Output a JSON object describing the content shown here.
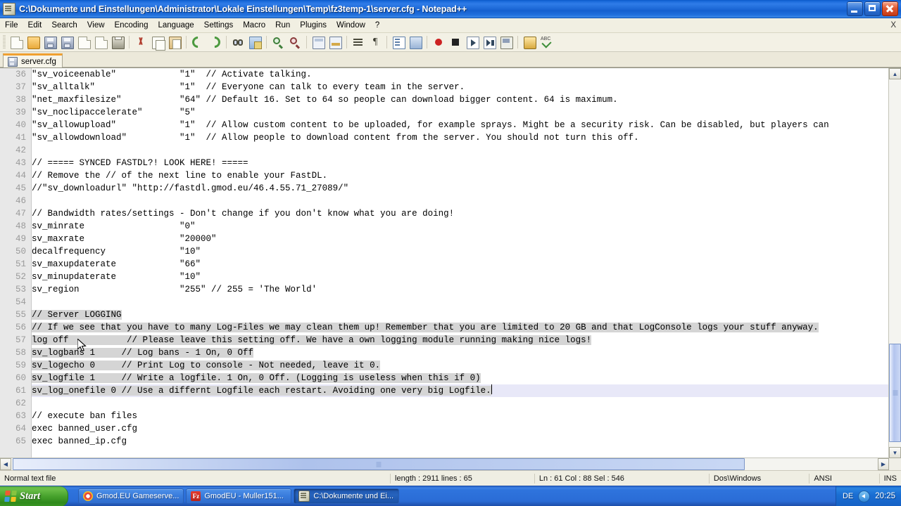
{
  "window": {
    "title": "C:\\Dokumente und Einstellungen\\Administrator\\Lokale Einstellungen\\Temp\\fz3temp-1\\server.cfg - Notepad++",
    "icon": "notepad-plus-plus-icon",
    "minimize_label": "Minimize",
    "maximize_label": "Restore",
    "close_label": "Close"
  },
  "menu": {
    "items": [
      {
        "label": "File"
      },
      {
        "label": "Edit"
      },
      {
        "label": "Search"
      },
      {
        "label": "View"
      },
      {
        "label": "Encoding"
      },
      {
        "label": "Language"
      },
      {
        "label": "Settings"
      },
      {
        "label": "Macro"
      },
      {
        "label": "Run"
      },
      {
        "label": "Plugins"
      },
      {
        "label": "Window"
      },
      {
        "label": "?"
      }
    ],
    "close_document_label": "X"
  },
  "toolbar": {
    "buttons": [
      {
        "name": "new-file-icon",
        "icon": "ic-doc"
      },
      {
        "name": "open-file-icon",
        "icon": "ic-folder"
      },
      {
        "name": "save-icon",
        "icon": "ic-save"
      },
      {
        "name": "save-all-icon",
        "icon": "ic-save"
      },
      {
        "name": "close-file-icon",
        "icon": "ic-doc"
      },
      {
        "name": "close-all-icon",
        "icon": "ic-doc"
      },
      {
        "name": "print-icon",
        "icon": "ic-print"
      },
      {
        "name": "sep",
        "icon": "sep"
      },
      {
        "name": "cut-icon",
        "icon": "ic-cut"
      },
      {
        "name": "copy-icon",
        "icon": "ic-copy"
      },
      {
        "name": "paste-icon",
        "icon": "ic-paste"
      },
      {
        "name": "sep",
        "icon": "sep"
      },
      {
        "name": "undo-icon",
        "icon": "ic-undo"
      },
      {
        "name": "redo-icon",
        "icon": "ic-redo"
      },
      {
        "name": "sep",
        "icon": "sep"
      },
      {
        "name": "find-icon",
        "icon": "ic-find"
      },
      {
        "name": "replace-icon",
        "icon": "ic-replace"
      },
      {
        "name": "sep",
        "icon": "sep"
      },
      {
        "name": "zoom-in-icon",
        "icon": "ic-zoomin"
      },
      {
        "name": "zoom-out-icon",
        "icon": "ic-zoomout"
      },
      {
        "name": "sep",
        "icon": "sep"
      },
      {
        "name": "sync-vertical-icon",
        "icon": "ic-sync"
      },
      {
        "name": "sync-horizontal-icon",
        "icon": "ic-sync2"
      },
      {
        "name": "sep",
        "icon": "sep"
      },
      {
        "name": "word-wrap-icon",
        "icon": "ic-wrap"
      },
      {
        "name": "show-all-chars-icon",
        "icon": "ic-pilcrow"
      },
      {
        "name": "sep",
        "icon": "sep"
      },
      {
        "name": "indent-guide-icon",
        "icon": "ic-indent"
      },
      {
        "name": "ui-doc-map-icon",
        "icon": "ic-docmap"
      },
      {
        "name": "sep",
        "icon": "sep"
      },
      {
        "name": "record-macro-icon",
        "icon": "ic-rec"
      },
      {
        "name": "stop-macro-icon",
        "icon": "ic-stop"
      },
      {
        "name": "play-macro-icon",
        "icon": "ic-play"
      },
      {
        "name": "run-macro-multiple-icon",
        "icon": "ic-playmulti"
      },
      {
        "name": "save-macro-icon",
        "icon": "ic-savemacro"
      },
      {
        "name": "sep",
        "icon": "sep"
      },
      {
        "name": "run-icon",
        "icon": "ic-plugin"
      },
      {
        "name": "spell-check-icon",
        "icon": "ic-spell"
      }
    ]
  },
  "tabs": [
    {
      "label": "server.cfg",
      "active": true
    }
  ],
  "editor": {
    "first_visible_line": 36,
    "lines": [
      {
        "n": 36,
        "text": "\"sv_voiceenable\"            \"1\"  // Activate talking."
      },
      {
        "n": 37,
        "text": "\"sv_alltalk\"                \"1\"  // Everyone can talk to every team in the server."
      },
      {
        "n": 38,
        "text": "\"net_maxfilesize\"           \"64\" // Default 16. Set to 64 so people can download bigger content. 64 is maximum."
      },
      {
        "n": 39,
        "text": "\"sv_noclipaccelerate\"       \"5\""
      },
      {
        "n": 40,
        "text": "\"sv_allowupload\"            \"1\"  // Allow custom content to be uploaded, for example sprays. Might be a security risk. Can be disabled, but players can"
      },
      {
        "n": 41,
        "text": "\"sv_allowdownload\"          \"1\"  // Allow people to download content from the server. You should not turn this off."
      },
      {
        "n": 42,
        "text": ""
      },
      {
        "n": 43,
        "text": "// ===== SYNCED FASTDL?! LOOK HERE! ====="
      },
      {
        "n": 44,
        "text": "// Remove the // of the next line to enable your FastDL."
      },
      {
        "n": 45,
        "text": "//\"sv_downloadurl\" \"http://fastdl.gmod.eu/46.4.55.71_27089/\""
      },
      {
        "n": 46,
        "text": ""
      },
      {
        "n": 47,
        "text": "// Bandwidth rates/settings - Don't change if you don't know what you are doing!"
      },
      {
        "n": 48,
        "text": "sv_minrate                  \"0\""
      },
      {
        "n": 49,
        "text": "sv_maxrate                  \"20000\""
      },
      {
        "n": 50,
        "text": "decalfrequency              \"10\""
      },
      {
        "n": 51,
        "text": "sv_maxupdaterate            \"66\""
      },
      {
        "n": 52,
        "text": "sv_minupdaterate            \"10\""
      },
      {
        "n": 53,
        "text": "sv_region                   \"255\" // 255 = 'The World'"
      },
      {
        "n": 54,
        "text": ""
      },
      {
        "n": 55,
        "text": "// Server LOGGING",
        "selected": true
      },
      {
        "n": 56,
        "text": "// If we see that you have to many Log-Files we may clean them up! Remember that you are limited to 20 GB and that LogConsole logs your stuff anyway.",
        "selected": true
      },
      {
        "n": 57,
        "text": "log off           // Please leave this setting off. We have a own logging module running making nice logs!",
        "selected": true
      },
      {
        "n": 58,
        "text": "sv_logbans 1     // Log bans - 1 On, 0 Off",
        "selected": true
      },
      {
        "n": 59,
        "text": "sv_logecho 0     // Print Log to console - Not needed, leave it 0.",
        "selected": true
      },
      {
        "n": 60,
        "text": "sv_logfile 1     // Write a logfile. 1 On, 0 Off. (Logging is useless when this if 0)",
        "selected": true
      },
      {
        "n": 61,
        "text": "sv_log_onefile 0 // Use a differnt Logfile each restart. Avoiding one very big Logfile.",
        "selected": true,
        "current": true,
        "caret_at_end": true
      },
      {
        "n": 62,
        "text": ""
      },
      {
        "n": 63,
        "text": "// execute ban files"
      },
      {
        "n": 64,
        "text": "exec banned_user.cfg"
      },
      {
        "n": 65,
        "text": "exec banned_ip.cfg"
      }
    ]
  },
  "statusbar": {
    "file_type": "Normal text file",
    "length_lines": "length : 2911   lines : 65",
    "position": "Ln : 61   Col : 88   Sel : 546",
    "eol": "Dos\\Windows",
    "encoding": "ANSI",
    "insert_mode": "INS"
  },
  "taskbar": {
    "start_label": "Start",
    "items": [
      {
        "label": "Gmod.EU Gameserve...",
        "icon": "chrome-icon",
        "active": false
      },
      {
        "label": "GmodEU - Muller151...",
        "icon": "filezilla-icon",
        "active": false
      },
      {
        "label": "C:\\Dokumente und Ei...",
        "icon": "notepad-plus-plus-icon",
        "active": true
      }
    ],
    "tray": {
      "language": "DE",
      "volume_icon": "volume-icon",
      "clock": "20:25"
    }
  },
  "colors": {
    "title_blue": "#1b6bdc",
    "toolbar_bg": "#f3f1e5",
    "selection_gray": "#d5d5d5",
    "current_line": "#e8e8f8",
    "tab_accent": "#f0a030",
    "taskbar_blue": "#2f74dd"
  }
}
